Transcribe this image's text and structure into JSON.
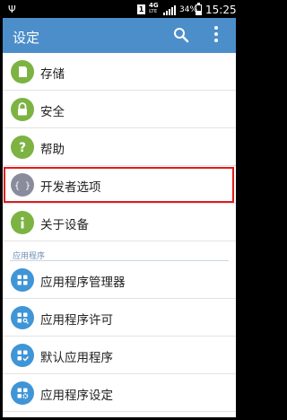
{
  "status_bar": {
    "usb_icon": "usb-icon",
    "sim_label": "1",
    "network": "4G",
    "network_sub": "LTE",
    "battery_text": "34%",
    "time": "15:25"
  },
  "app_bar": {
    "title": "设定",
    "search_icon": "search-icon",
    "more_icon": "more-vertical-icon",
    "color": "#4c8ec9"
  },
  "items": [
    {
      "label": "存储",
      "icon": "storage-icon",
      "color": "#7cb342"
    },
    {
      "label": "安全",
      "icon": "lock-icon",
      "color": "#7cb342"
    },
    {
      "label": "帮助",
      "icon": "help-icon",
      "color": "#7cb342"
    },
    {
      "label": "开发者选项",
      "icon": "developer-options-icon",
      "color": "#8a8c9e",
      "highlighted": true
    },
    {
      "label": "关于设备",
      "icon": "info-icon",
      "color": "#7cb342"
    }
  ],
  "section": {
    "title": "应用程序"
  },
  "app_items": [
    {
      "label": "应用程序管理器",
      "icon": "app-grid-icon",
      "color": "#3f95d6"
    },
    {
      "label": "应用程序许可",
      "icon": "app-grid-key-icon",
      "color": "#3f95d6"
    },
    {
      "label": "默认应用程序",
      "icon": "app-grid-check-icon",
      "color": "#3f95d6"
    },
    {
      "label": "应用程序设定",
      "icon": "app-grid-gear-icon",
      "color": "#3f95d6"
    }
  ],
  "highlight_color": "#e21a1a"
}
